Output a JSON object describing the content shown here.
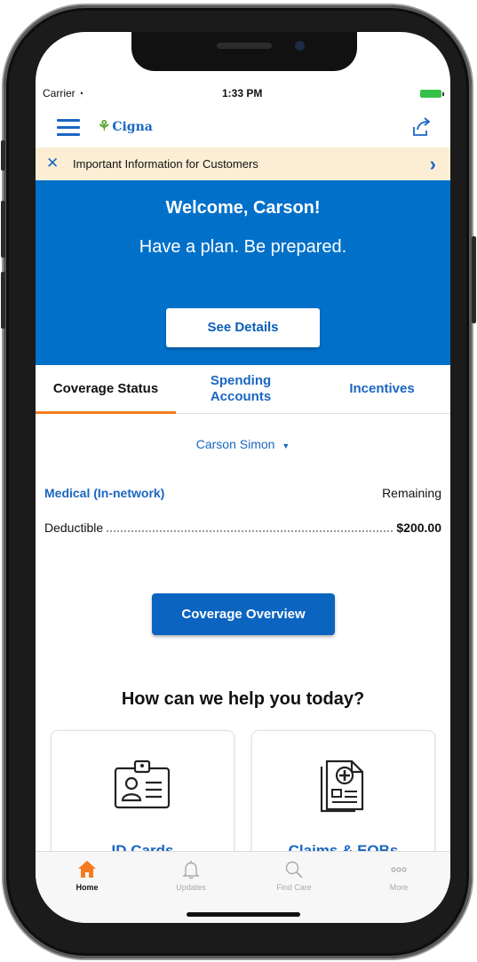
{
  "status_bar": {
    "carrier": "Carrier",
    "wifi_icon": "wifi-icon",
    "time": "1:33 PM",
    "battery_color": "#38c14a"
  },
  "header": {
    "menu_icon": "hamburger-menu-icon",
    "logo_text": "Cigna",
    "logo_icon": "cigna-tree-icon",
    "share_icon": "share-icon"
  },
  "banner": {
    "text": "Important Information for Customers",
    "close_icon": "close-icon",
    "chevron_icon": "chevron-right-icon",
    "background": "#fbeed5"
  },
  "hero": {
    "title": "Welcome, Carson!",
    "subtitle": "Have a plan. Be prepared.",
    "button_label": "See Details",
    "background": "#0070c9"
  },
  "tabs": [
    {
      "label": "Coverage Status",
      "active": true
    },
    {
      "label": "Spending Accounts",
      "active": false
    },
    {
      "label": "Incentives",
      "active": false
    }
  ],
  "coverage": {
    "member_name": "Carson Simon",
    "member_dropdown_icon": "caret-down-icon",
    "plan_label": "Medical (In-network)",
    "remaining_label": "Remaining",
    "deductible_label": "Deductible",
    "deductible_amount": "$200.00",
    "overview_button": "Coverage Overview"
  },
  "help": {
    "heading": "How can we help you today?",
    "cards": [
      {
        "label": "ID Cards",
        "icon": "id-card-icon"
      },
      {
        "label": "Claims & EOBs",
        "icon": "claims-document-icon"
      }
    ]
  },
  "tab_bar": {
    "items": [
      {
        "label": "Home",
        "icon": "home-icon",
        "active": true
      },
      {
        "label": "Updates",
        "icon": "bell-icon",
        "active": false
      },
      {
        "label": "Find Care",
        "icon": "search-icon",
        "active": false
      },
      {
        "label": "More",
        "icon": "more-icon",
        "active": false
      }
    ]
  },
  "colors": {
    "accent": "#1a66c2",
    "primary_button": "#0b64c0",
    "active_tab": "#f47c20"
  }
}
